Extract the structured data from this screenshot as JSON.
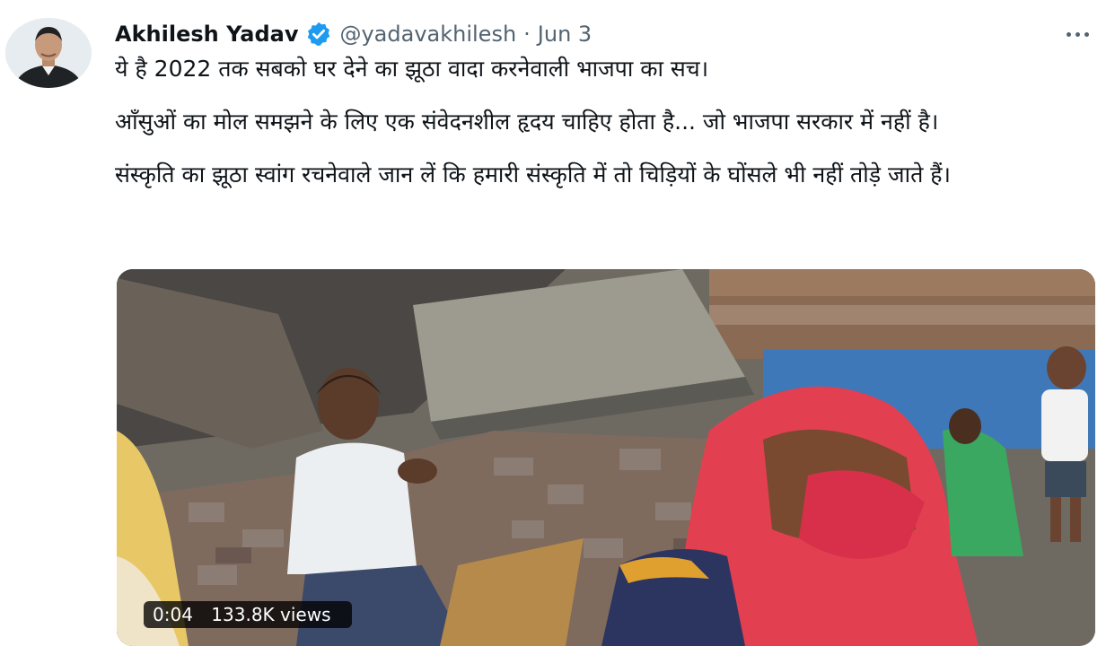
{
  "tweet": {
    "author_name": "Akhilesh Yadav",
    "handle": "@yadavakhilesh",
    "separator": "·",
    "date": "Jun 3",
    "paragraphs": [
      "ये है 2022 तक सबको घर देने का झूठा वादा करनेवाली भाजपा का सच।",
      "आँसुओं का मोल समझने के लिए एक संवेदनशील हृदय चाहिए होता है... जो भाजपा सरकार में नहीं है।",
      "संस्कृति का झूठा स्वांग रचनेवाले जान लें कि हमारी संस्कृति में तो चिड़ियों के घोंसले भी नहीं तोड़े जाते हैं।"
    ]
  },
  "media": {
    "type": "video",
    "duration": "0:04",
    "views": "133.8K views"
  },
  "icons": {
    "verified": "verified-badge-icon",
    "more": "more-options-icon"
  },
  "colors": {
    "verified_blue": "#1d9bf0",
    "secondary_text": "#536471",
    "primary_text": "#0f1419"
  }
}
